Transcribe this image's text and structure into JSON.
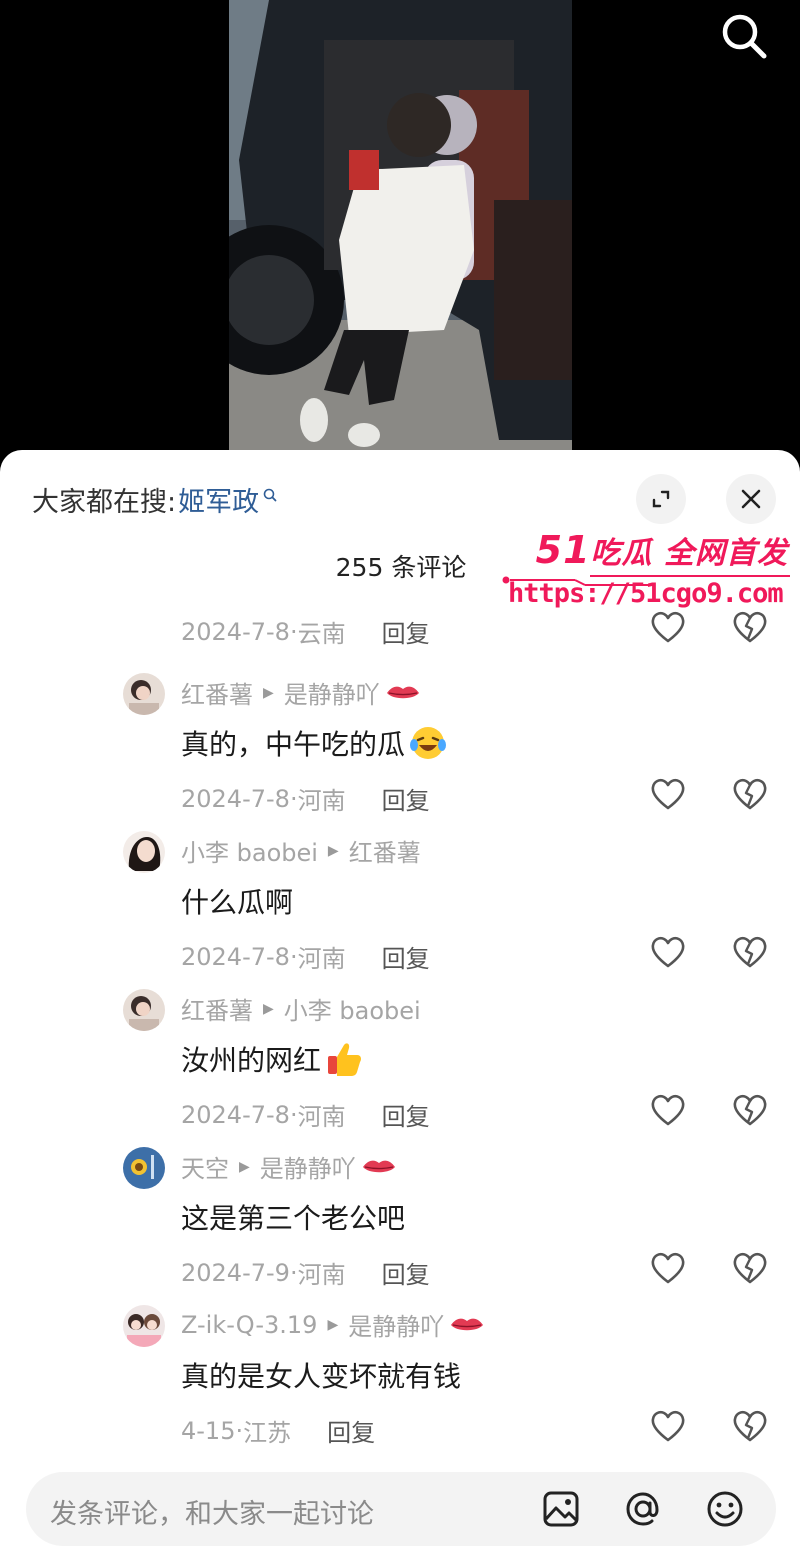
{
  "hot_search": {
    "label": "大家都在搜:",
    "keyword": "姬军政"
  },
  "comment_count": "255 条评论",
  "watermark": {
    "brand_num": "51",
    "brand_text": "吃瓜 全网首发",
    "url": "https://51cgo9.com"
  },
  "comments": [
    {
      "user": "",
      "reply_to": "",
      "text": "",
      "date": "2024-7-8",
      "location": "云南",
      "reply": "回复"
    },
    {
      "user": "红番薯",
      "reply_to": "是静静吖",
      "text": "真的，中午吃的瓜",
      "date": "2024-7-8",
      "location": "河南",
      "reply": "回复",
      "emoji": "laughing-crying-emoji"
    },
    {
      "user": "小李 baobei",
      "reply_to": "红番薯",
      "text": "什么瓜啊",
      "date": "2024-7-8",
      "location": "河南",
      "reply": "回复"
    },
    {
      "user": "红番薯",
      "reply_to": "小李 baobei",
      "text": "汝州的网红",
      "date": "2024-7-8",
      "location": "河南",
      "reply": "回复",
      "emoji": "thumbs-up-emoji"
    },
    {
      "user": "天空",
      "reply_to": "是静静吖",
      "text": "这是第三个老公吧",
      "date": "2024-7-9",
      "location": "河南",
      "reply": "回复"
    },
    {
      "user": "Z-ik-Q-3.19",
      "reply_to": "是静静吖",
      "text": "真的是女人变坏就有钱",
      "date": "4-15",
      "location": "江苏",
      "reply": "回复"
    }
  ],
  "input": {
    "placeholder": "发条评论，和大家一起讨论"
  },
  "icons": [
    "search-icon",
    "expand-icon",
    "close-icon",
    "heart-icon",
    "broken-heart-icon",
    "image-icon",
    "at-icon",
    "emoji-icon",
    "lips-icon"
  ],
  "colors": {
    "keyword": "#2f5d96",
    "watermark": "#f0195a",
    "meta": "#a5a5a5"
  }
}
